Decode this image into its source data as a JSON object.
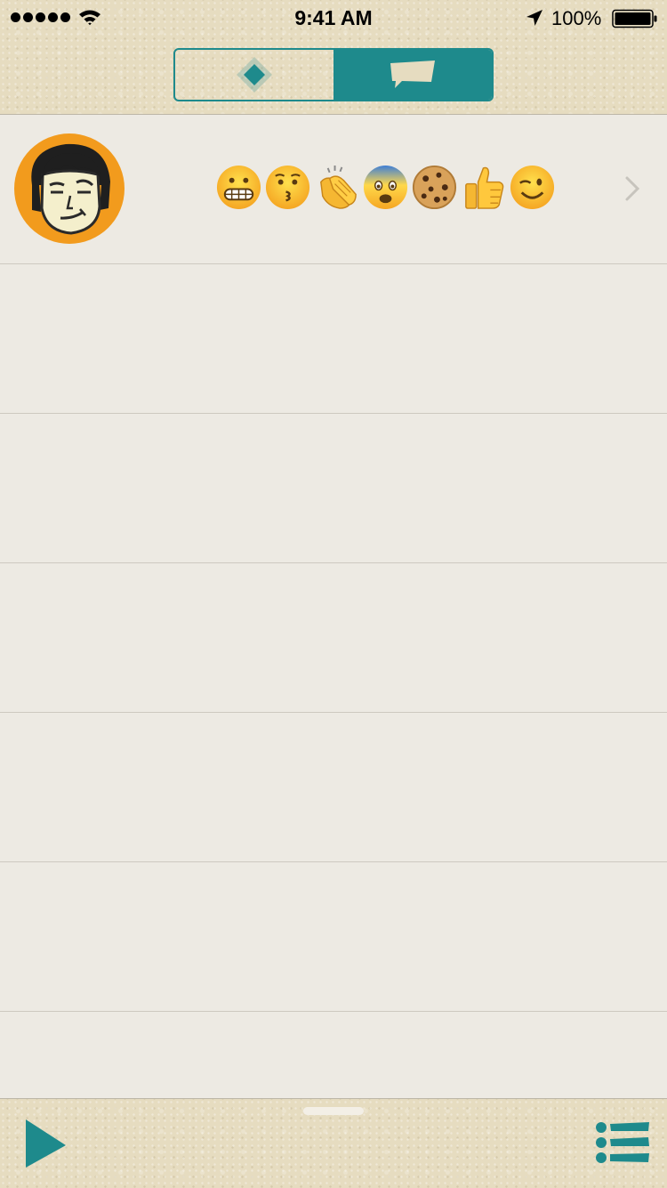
{
  "status_bar": {
    "signal_dots": 5,
    "time": "9:41 AM",
    "battery_percent": "100%",
    "battery_level": 1.0
  },
  "segmented_control": {
    "segments": [
      {
        "icon": "diamond-icon",
        "selected": false
      },
      {
        "icon": "speech-bubble-icon",
        "selected": true
      }
    ],
    "accent_color": "#1e8a8c"
  },
  "rows": [
    {
      "avatar": "cartoon-face-avatar",
      "avatar_color": "#f29b1d",
      "emojis": [
        "grimacing-face",
        "kissing-face",
        "clapping-hands",
        "fearful-face",
        "cookie",
        "thumbs-up",
        "winking-face"
      ],
      "has_chevron": true
    },
    {
      "empty": true
    },
    {
      "empty": true
    },
    {
      "empty": true
    },
    {
      "empty": true
    },
    {
      "empty": true
    }
  ],
  "toolbar": {
    "play_icon": "play-icon",
    "list_icon": "list-icon"
  },
  "colors": {
    "accent": "#1e8a8c",
    "row_background": "#edeae3",
    "paper": "#e6dcc0"
  }
}
